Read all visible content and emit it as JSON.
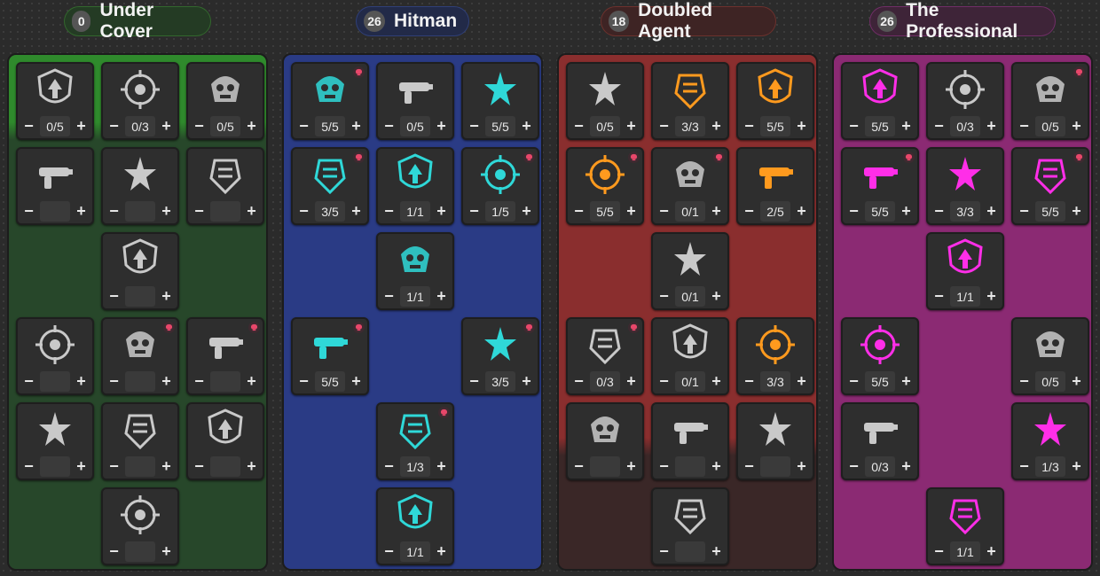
{
  "theme": {
    "skull_color": "#e8476a",
    "locked_icon_color": "#8a8a8a",
    "unlocked_icon_color": "#c9c9c9"
  },
  "trees": [
    {
      "name": "Under Cover",
      "points": "0",
      "color": "#4fbf40",
      "header_bg": "#243b24",
      "panel_bg": "#27472a",
      "panel_top_bg": "#2f8a2c",
      "icon_color": "#c9c9c9",
      "skills": [
        {
          "icon": "shield-arrow-icon",
          "value": "0/5",
          "skull": false,
          "active": false
        },
        {
          "icon": "dna-burst-icon",
          "value": "0/3",
          "skull": false,
          "active": false
        },
        {
          "icon": "shield-hourglass-icon",
          "value": "0/5",
          "skull": false,
          "active": false
        },
        {
          "icon": "skull-burst-icon",
          "value": "",
          "skull": false,
          "active": false
        },
        {
          "icon": "shield-medic-icon",
          "value": "",
          "skull": false,
          "active": false
        },
        {
          "icon": "shield-cross-icon",
          "value": "",
          "skull": false,
          "active": false
        },
        {
          "icon": "badge-shield-icon",
          "value": "",
          "skull": false,
          "active": false
        },
        {
          "icon": "compass-shock-icon",
          "value": "",
          "skull": false,
          "active": false
        },
        {
          "icon": "frozen-heart-icon",
          "value": "",
          "skull": true,
          "active": false
        },
        {
          "icon": "canister-icon",
          "value": "",
          "skull": true,
          "active": false
        },
        {
          "icon": "frozen-pistol-icon",
          "value": "",
          "skull": false,
          "active": false
        },
        {
          "icon": "frozen-shield-icon",
          "value": "",
          "skull": false,
          "active": false
        },
        {
          "icon": "crosshair-icon",
          "value": "",
          "skull": false,
          "active": false
        },
        {
          "icon": "armored-helmet-icon",
          "value": "",
          "skull": false,
          "active": false
        }
      ]
    },
    {
      "name": "Hitman",
      "points": "26",
      "color": "#4a6ad6",
      "header_bg": "#222a48",
      "panel_bg": "#2a3b85",
      "panel_top_bg": "#2a3b85",
      "icon_color": "#2fd8d8",
      "skills": [
        {
          "icon": "shotgun-icon",
          "value": "5/5",
          "skull": true,
          "active": true
        },
        {
          "icon": "reload-gun-icon",
          "value": "0/5",
          "skull": false,
          "active": false
        },
        {
          "icon": "rabbit-burst-icon",
          "value": "5/5",
          "skull": false,
          "active": true
        },
        {
          "icon": "ammo-card-icon",
          "value": "3/5",
          "skull": true,
          "active": true
        },
        {
          "icon": "grenade-icon",
          "value": "1/1",
          "skull": false,
          "active": true
        },
        {
          "icon": "fangs-icon",
          "value": "1/5",
          "skull": true,
          "active": true
        },
        {
          "icon": "skull-pedestal-icon",
          "value": "1/1",
          "skull": false,
          "active": true
        },
        {
          "icon": "bullet-spread-icon",
          "value": "5/5",
          "skull": true,
          "active": true
        },
        {
          "icon": "bullet-pair-icon",
          "value": "3/5",
          "skull": true,
          "active": true
        },
        {
          "icon": "hourglass-burst-icon",
          "value": "1/3",
          "skull": true,
          "active": true
        },
        {
          "icon": "reaper-icon",
          "value": "1/1",
          "skull": false,
          "active": true
        }
      ]
    },
    {
      "name": "Doubled Agent",
      "points": "18",
      "color": "#c84b3e",
      "header_bg": "#3e2424",
      "panel_bg": "#8a2e2e",
      "panel_top_bg": "#8a2e2e",
      "icon_color": "#ff9a1e",
      "skills": [
        {
          "icon": "holster-icon",
          "value": "0/5",
          "skull": false,
          "active": false
        },
        {
          "icon": "magazine-icon",
          "value": "3/3",
          "skull": false,
          "active": true
        },
        {
          "icon": "clock-bomb-icon",
          "value": "5/5",
          "skull": false,
          "active": true
        },
        {
          "icon": "tactical-vest-icon",
          "value": "5/5",
          "skull": true,
          "active": true
        },
        {
          "icon": "head-grenade-icon",
          "value": "0/1",
          "skull": true,
          "active": false
        },
        {
          "icon": "bandage-icon",
          "value": "2/5",
          "skull": false,
          "active": true
        },
        {
          "icon": "shield-fist-icon",
          "value": "0/1",
          "skull": false,
          "active": false
        },
        {
          "icon": "basket-icon",
          "value": "0/3",
          "skull": true,
          "active": false
        },
        {
          "icon": "pirate-skull-icon",
          "value": "0/1",
          "skull": false,
          "active": false
        },
        {
          "icon": "running-rabbit-icon",
          "value": "3/3",
          "skull": false,
          "active": true
        },
        {
          "icon": "hand-icon",
          "value": "",
          "skull": false,
          "active": false
        },
        {
          "icon": "torso-icon",
          "value": "",
          "skull": false,
          "active": false
        },
        {
          "icon": "grappling-icon",
          "value": "",
          "skull": false,
          "active": false
        },
        {
          "icon": "pistol-icon",
          "value": "",
          "skull": false,
          "active": false
        }
      ]
    },
    {
      "name": "The Professional",
      "points": "26",
      "color": "#d640c4",
      "header_bg": "#3e2438",
      "panel_bg": "#8b2a73",
      "panel_top_bg": "#8b2a73",
      "icon_color": "#ff2ee8",
      "skills": [
        {
          "icon": "smg-icon",
          "value": "5/5",
          "skull": false,
          "active": true
        },
        {
          "icon": "skull-crossbones-icon",
          "value": "0/3",
          "skull": false,
          "active": false
        },
        {
          "icon": "rocket-icon",
          "value": "0/5",
          "skull": true,
          "active": false
        },
        {
          "icon": "target-icon",
          "value": "5/5",
          "skull": true,
          "active": true
        },
        {
          "icon": "winged-rabbit-icon",
          "value": "3/3",
          "skull": false,
          "active": true
        },
        {
          "icon": "arrow-target-icon",
          "value": "5/5",
          "skull": true,
          "active": true
        },
        {
          "icon": "sprinter-icon",
          "value": "1/1",
          "skull": false,
          "active": true
        },
        {
          "icon": "armor-plate-icon",
          "value": "5/5",
          "skull": false,
          "active": true
        },
        {
          "icon": "smoke-grenade-icon",
          "value": "0/5",
          "skull": false,
          "active": false
        },
        {
          "icon": "pocket-watch-skull-icon",
          "value": "0/3",
          "skull": false,
          "active": false
        },
        {
          "icon": "heart-arrow-icon",
          "value": "1/3",
          "skull": false,
          "active": true
        },
        {
          "icon": "magnifier-icon",
          "value": "1/1",
          "skull": false,
          "active": true
        }
      ]
    }
  ],
  "controls": {
    "minus": "−",
    "plus": "+"
  }
}
